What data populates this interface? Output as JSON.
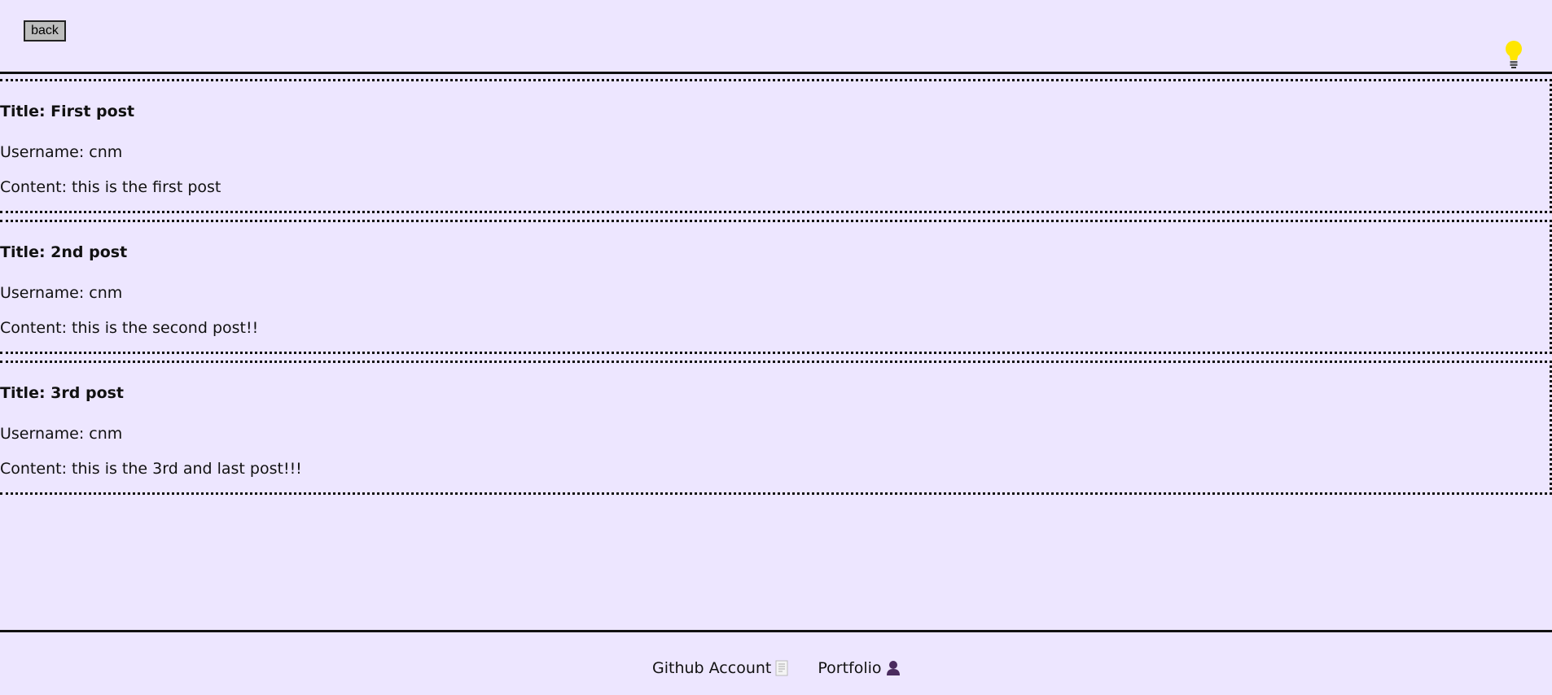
{
  "header": {
    "back_label": "back",
    "theme_icon": "lightbulb-icon",
    "theme_icon_color": "#ffe600"
  },
  "posts": [
    {
      "title": "Title: First post",
      "username": "Username: cnm",
      "content": "Content: this is the first post"
    },
    {
      "title": "Title: 2nd post",
      "username": "Username: cnm",
      "content": "Content: this is the second post!!"
    },
    {
      "title": "Title: 3rd post",
      "username": "Username: cnm",
      "content": "Content: this is the 3rd and last post!!!"
    }
  ],
  "footer": {
    "links": [
      {
        "label": "Github Account",
        "icon": "document-icon"
      },
      {
        "label": "Portfolio",
        "icon": "person-icon"
      }
    ]
  },
  "colors": {
    "background": "#ede6ff",
    "border": "#111111",
    "person_icon": "#4a2b5e"
  }
}
